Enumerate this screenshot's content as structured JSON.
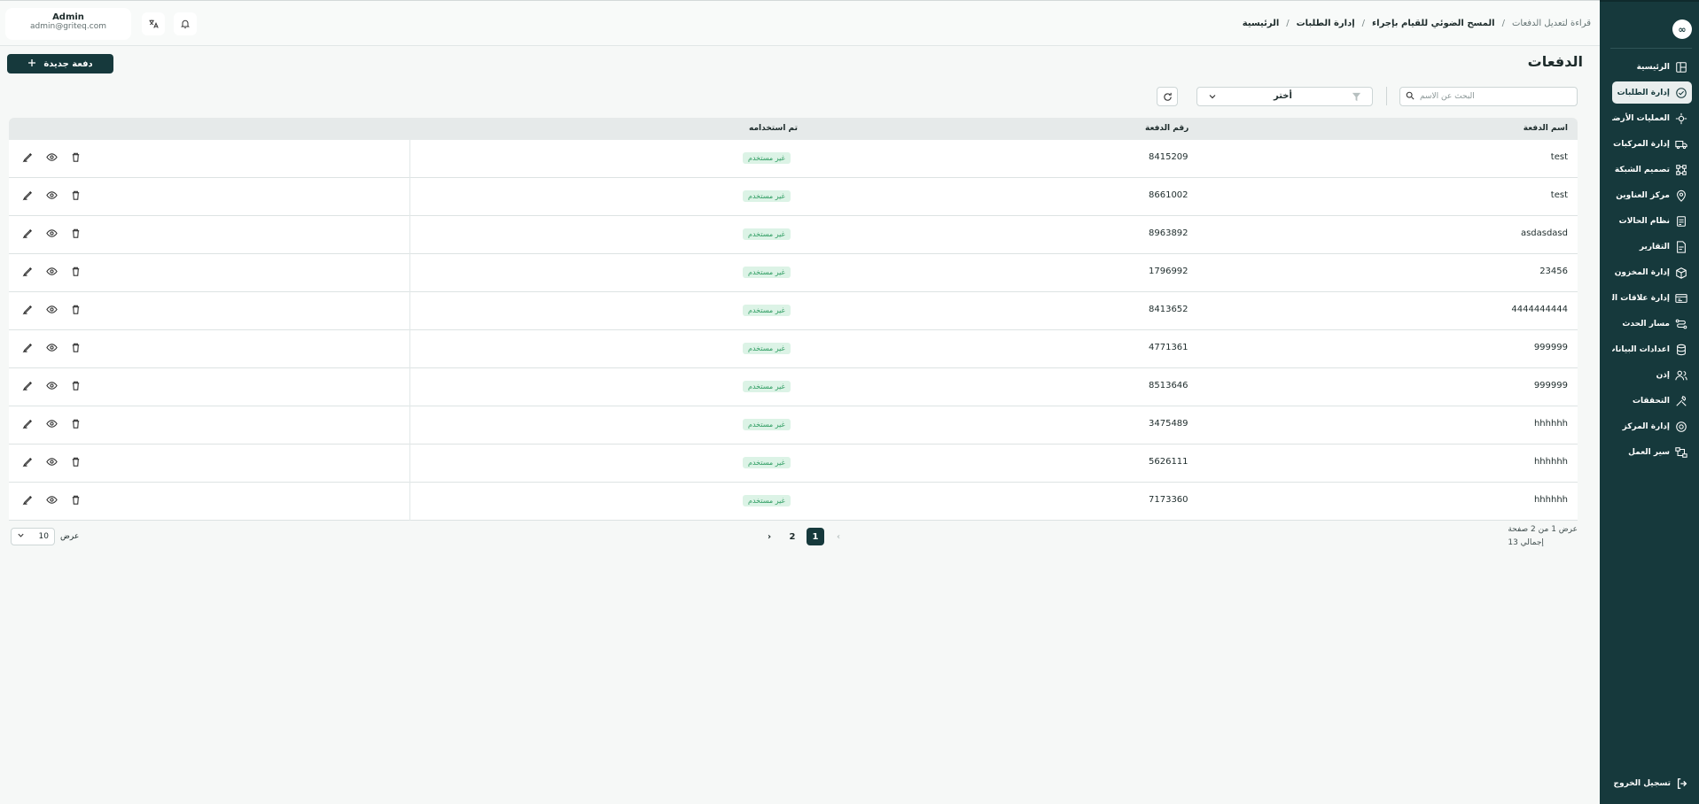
{
  "sidebar": {
    "logo": "∞",
    "items": [
      {
        "label": "الرئيسية",
        "icon": "layout-icon",
        "active": false
      },
      {
        "label": "إدارة الطلبات",
        "icon": "orders-icon",
        "active": true
      },
      {
        "label": "العمليات الأرضية",
        "icon": "ground-ops-icon",
        "active": false
      },
      {
        "label": "إدارة المركبات",
        "icon": "truck-icon",
        "active": false
      },
      {
        "label": "تصميم الشبكة",
        "icon": "network-icon",
        "active": false
      },
      {
        "label": "مركز العناوين",
        "icon": "map-pin-icon",
        "active": false
      },
      {
        "label": "نظام الحالات",
        "icon": "status-icon",
        "active": false
      },
      {
        "label": "التقارير",
        "icon": "report-icon",
        "active": false
      },
      {
        "label": "إدارة المخزون",
        "icon": "inventory-icon",
        "active": false
      },
      {
        "label": "إدارة علاقات العملاء",
        "icon": "crm-icon",
        "active": false
      },
      {
        "label": "مسار الحدث",
        "icon": "route-icon",
        "active": false
      },
      {
        "label": "اعدادات البيانات",
        "icon": "database-icon",
        "active": false
      },
      {
        "label": "إذن",
        "icon": "users-icon",
        "active": false
      },
      {
        "label": "التحققات",
        "icon": "tools-icon",
        "active": false
      },
      {
        "label": "إدارة المركز",
        "icon": "center-icon",
        "active": false
      },
      {
        "label": "سير العمل",
        "icon": "workflow-icon",
        "active": false
      }
    ],
    "logout": "تسجيل الخروج"
  },
  "header": {
    "user_name": "Admin",
    "user_email": "admin@griteq.com",
    "breadcrumb": [
      "الرئيسية",
      "إدارة الطلبات",
      "المسح الضوئي للقيام بإجراء",
      "قراءة لتعديل الدفعات"
    ]
  },
  "main": {
    "title": "الدفعات",
    "new_button": "دفعة جديدة",
    "search_placeholder": "البحث عن الاسم",
    "filter_label": "أختر",
    "columns": {
      "name": "اسم الدفعة",
      "number": "رقم الدفعة",
      "used": "تم استخدامه"
    },
    "rows": [
      {
        "name": "test",
        "number": "8415209",
        "status": "غير مستخدم"
      },
      {
        "name": "test",
        "number": "8661002",
        "status": "غير مستخدم"
      },
      {
        "name": "asdasdasd",
        "number": "8963892",
        "status": "غير مستخدم"
      },
      {
        "name": "23456",
        "number": "1796992",
        "status": "غير مستخدم"
      },
      {
        "name": "4444444444",
        "number": "8413652",
        "status": "غير مستخدم"
      },
      {
        "name": "999999",
        "number": "4771361",
        "status": "غير مستخدم"
      },
      {
        "name": "999999",
        "number": "8513646",
        "status": "غير مستخدم"
      },
      {
        "name": "hhhhhh",
        "number": "3475489",
        "status": "غير مستخدم"
      },
      {
        "name": "hhhhhh",
        "number": "5626111",
        "status": "غير مستخدم"
      },
      {
        "name": "hhhhhh",
        "number": "7173360",
        "status": "غير مستخدم"
      }
    ]
  },
  "pagination": {
    "showing": "عرض 1 من 2 صفحة",
    "total": "إجمالي 13",
    "pages": [
      "1",
      "2"
    ],
    "current_page": "1",
    "size_label": "عرض",
    "page_size": "10"
  },
  "colors": {
    "primary": "#16393c",
    "badge_bg": "#dcf3e6",
    "badge_text": "#2f9d62"
  }
}
